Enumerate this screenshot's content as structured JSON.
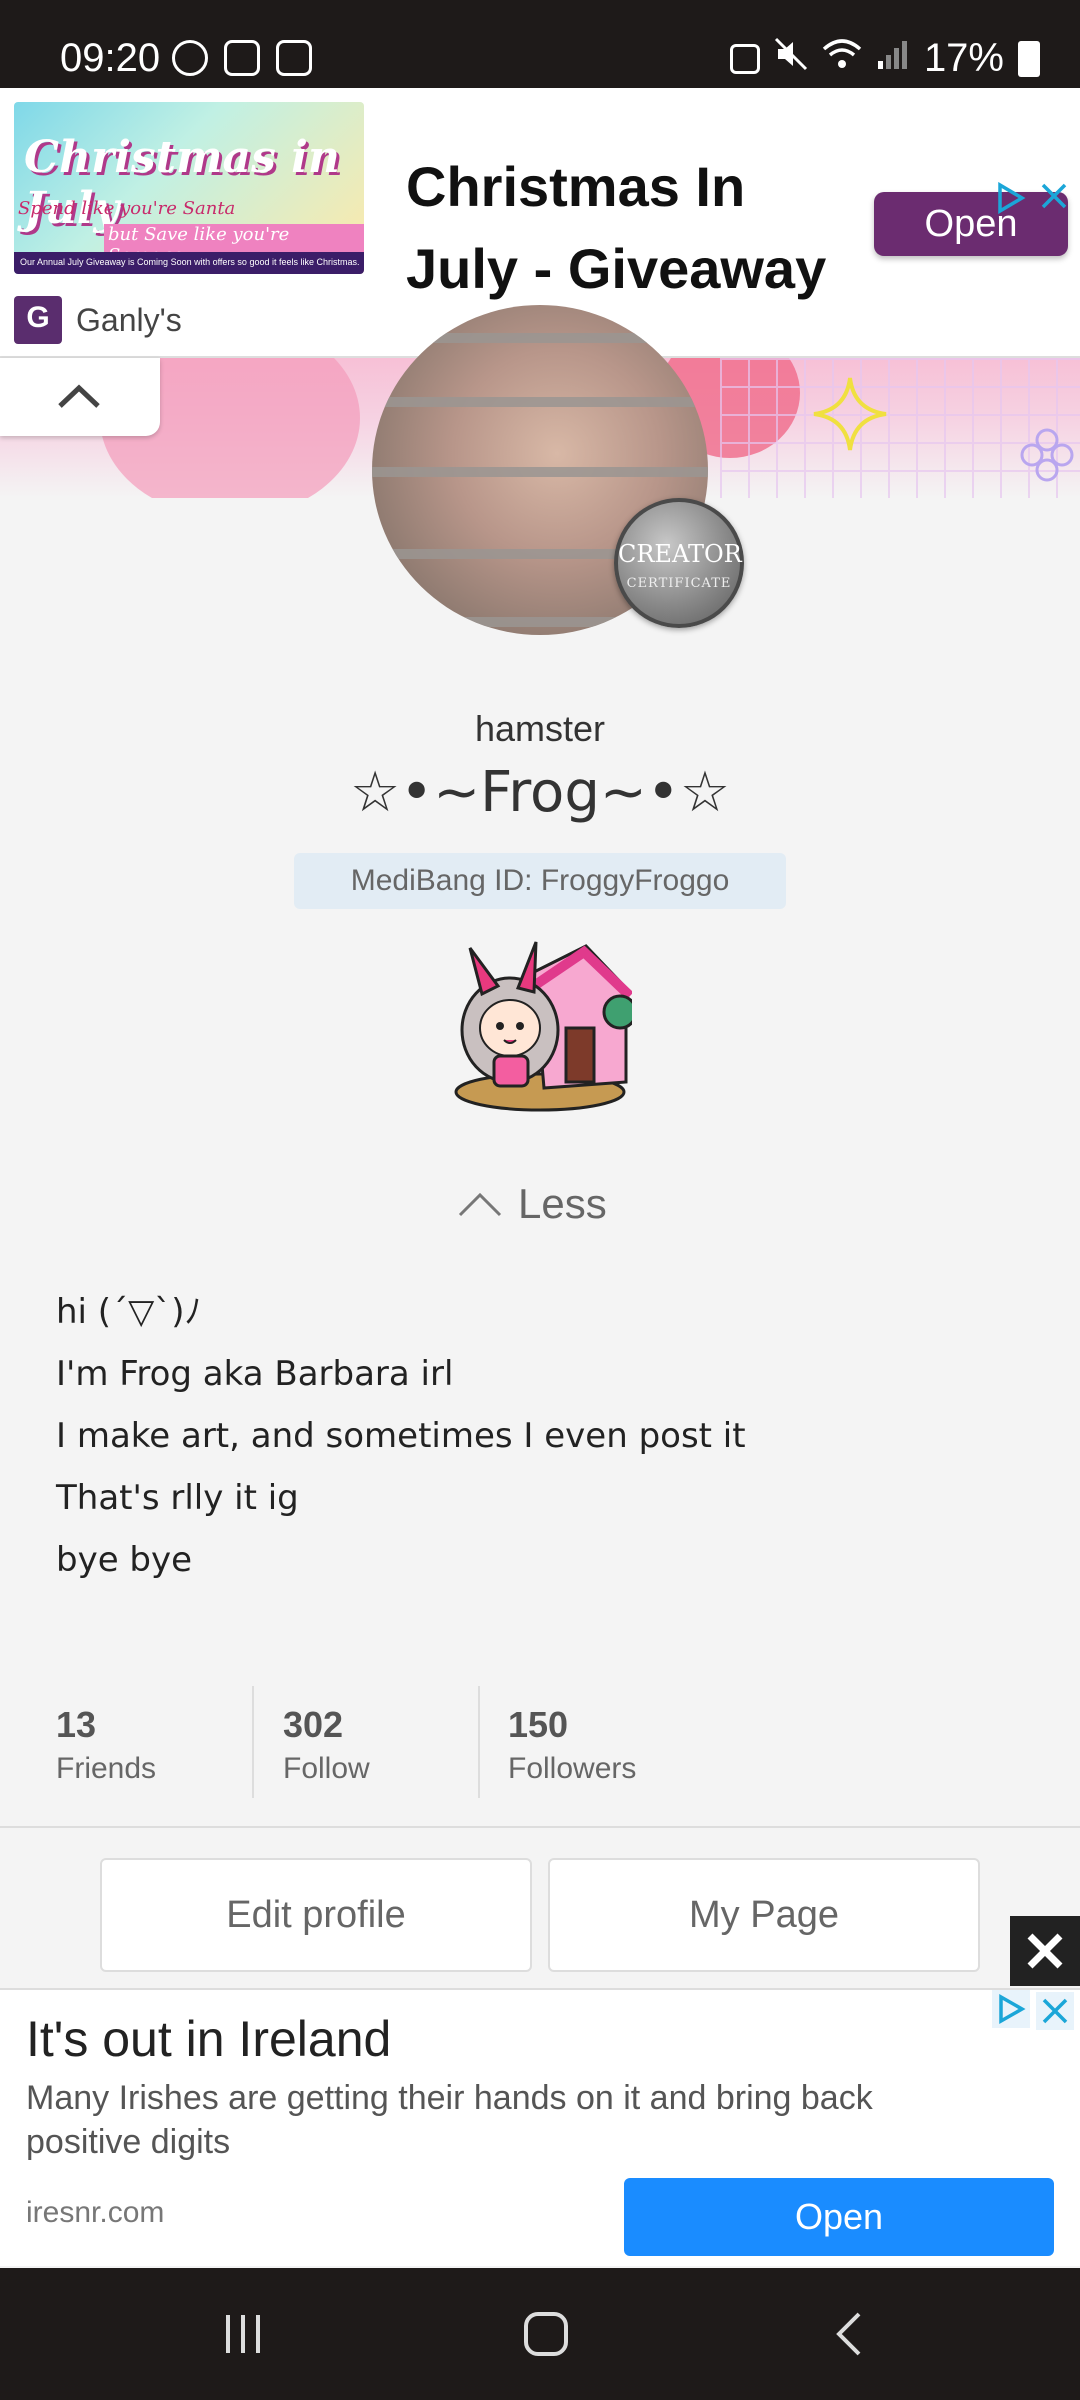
{
  "status_bar": {
    "time": "09:20",
    "battery": "17%"
  },
  "top_ad": {
    "image_title": "Christmas in July",
    "image_sub1": "Spend like you're Santa",
    "image_sub2": "but Save like you're Scrooge",
    "image_footer": "Our Annual July Giveaway is Coming Soon with offers so good it feels like Christmas.",
    "headline": "Christmas In July - Giveaway",
    "open_label": "Open",
    "brand_name": "Ganly's",
    "brand_logo_letter": "G"
  },
  "profile": {
    "subtitle": "hamster",
    "name": "☆•~Frog~•☆",
    "medibang_id": "MediBang ID: FroggyFroggo",
    "badge_line1": "CREATOR",
    "badge_line2": "CERTIFICATE",
    "toggle_label": "Less"
  },
  "bio": [
    "hi (´▽`)ﾉ",
    "I'm Frog aka Barbara irl",
    "I make art, and sometimes I even post it",
    "That's rlly it ig",
    "bye bye"
  ],
  "stats": [
    {
      "value": "13",
      "label": "Friends"
    },
    {
      "value": "302",
      "label": "Follow"
    },
    {
      "value": "150",
      "label": "Followers"
    }
  ],
  "actions": {
    "edit_profile": "Edit profile",
    "my_page": "My Page"
  },
  "bottom_ad": {
    "title": "It's out in Ireland",
    "description": "Many Irishes are getting their hands on it and bring back positive digits",
    "domain": "iresnr.com",
    "open_label": "Open"
  },
  "colors": {
    "ad_open_purple": "#6b2c70",
    "ad_open_blue": "#1a8cff",
    "badge_bg": "#e2ecf4"
  }
}
